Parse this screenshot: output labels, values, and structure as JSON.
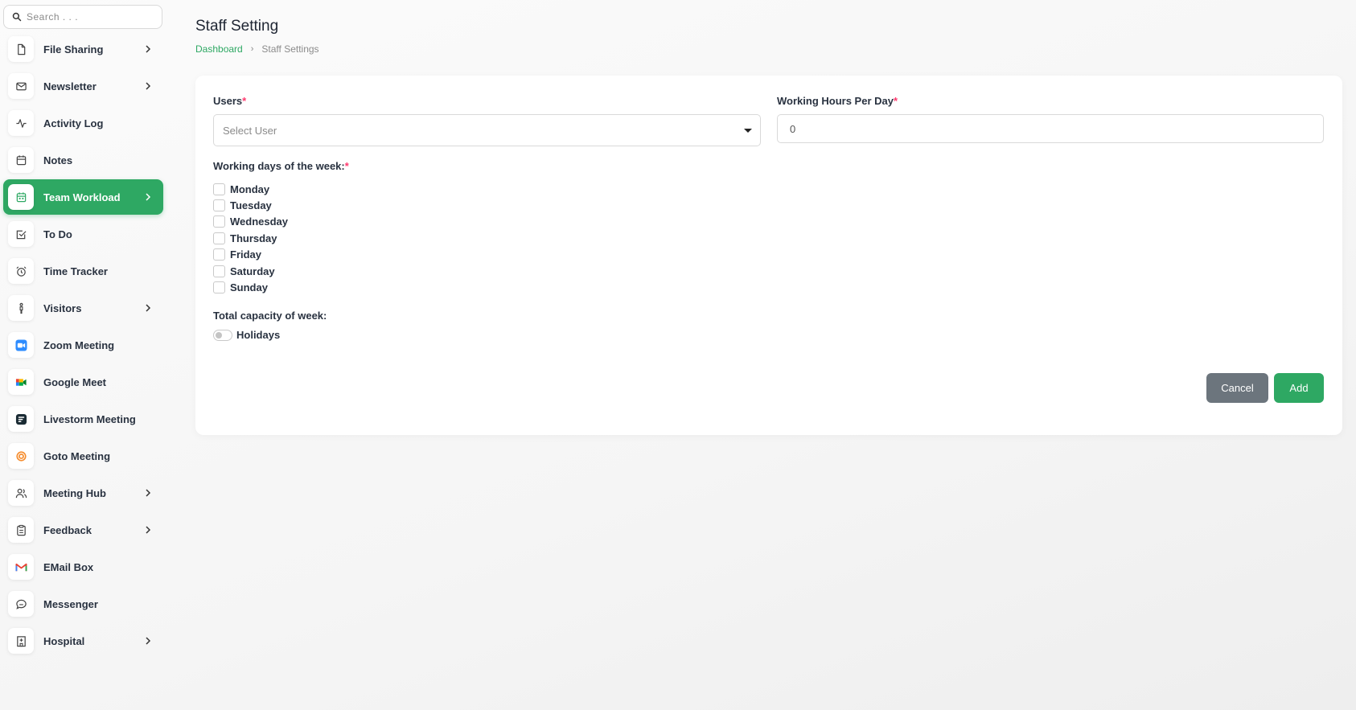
{
  "search": {
    "placeholder": "Search . . ."
  },
  "sidebar": {
    "items": [
      {
        "label": "File Sharing",
        "icon": "file-icon",
        "chevron": true
      },
      {
        "label": "Newsletter",
        "icon": "mail-icon",
        "chevron": true
      },
      {
        "label": "Activity Log",
        "icon": "activity-icon",
        "chevron": false
      },
      {
        "label": "Notes",
        "icon": "calendar-icon",
        "chevron": false
      },
      {
        "label": "Team Workload",
        "icon": "calendar-icon",
        "chevron": true,
        "active": true
      },
      {
        "label": "To Do",
        "icon": "checkbox-icon",
        "chevron": false
      },
      {
        "label": "Time Tracker",
        "icon": "alarm-clock-icon",
        "chevron": false
      },
      {
        "label": "Visitors",
        "icon": "person-icon",
        "chevron": true
      },
      {
        "label": "Zoom Meeting",
        "icon": "zoom-icon",
        "chevron": false
      },
      {
        "label": "Google Meet",
        "icon": "google-meet-icon",
        "chevron": false
      },
      {
        "label": "Livestorm Meeting",
        "icon": "livestorm-icon",
        "chevron": false
      },
      {
        "label": "Goto Meeting",
        "icon": "goto-meeting-icon",
        "chevron": false
      },
      {
        "label": "Meeting Hub",
        "icon": "users-icon",
        "chevron": true
      },
      {
        "label": "Feedback",
        "icon": "clipboard-icon",
        "chevron": true
      },
      {
        "label": "EMail Box",
        "icon": "gmail-icon",
        "chevron": false
      },
      {
        "label": "Messenger",
        "icon": "chat-icon",
        "chevron": false
      },
      {
        "label": "Hospital",
        "icon": "building-icon",
        "chevron": true
      }
    ]
  },
  "header": {
    "title": "Staff Setting",
    "breadcrumb": {
      "home": "Dashboard",
      "current": "Staff Settings"
    }
  },
  "form": {
    "users_label": "Users",
    "users_placeholder": "Select User",
    "hours_label": "Working Hours Per Day",
    "hours_value": "0",
    "required_mark": "*",
    "days_label": "Working days of the week:",
    "days": [
      "Monday",
      "Tuesday",
      "Wednesday",
      "Thursday",
      "Friday",
      "Saturday",
      "Sunday"
    ],
    "capacity_label": "Total capacity of week:",
    "holidays_label": "Holidays",
    "cancel_label": "Cancel",
    "add_label": "Add"
  },
  "colors": {
    "accent": "#2ea863",
    "secondary": "#6c757d",
    "required": "#ff3a6e"
  }
}
